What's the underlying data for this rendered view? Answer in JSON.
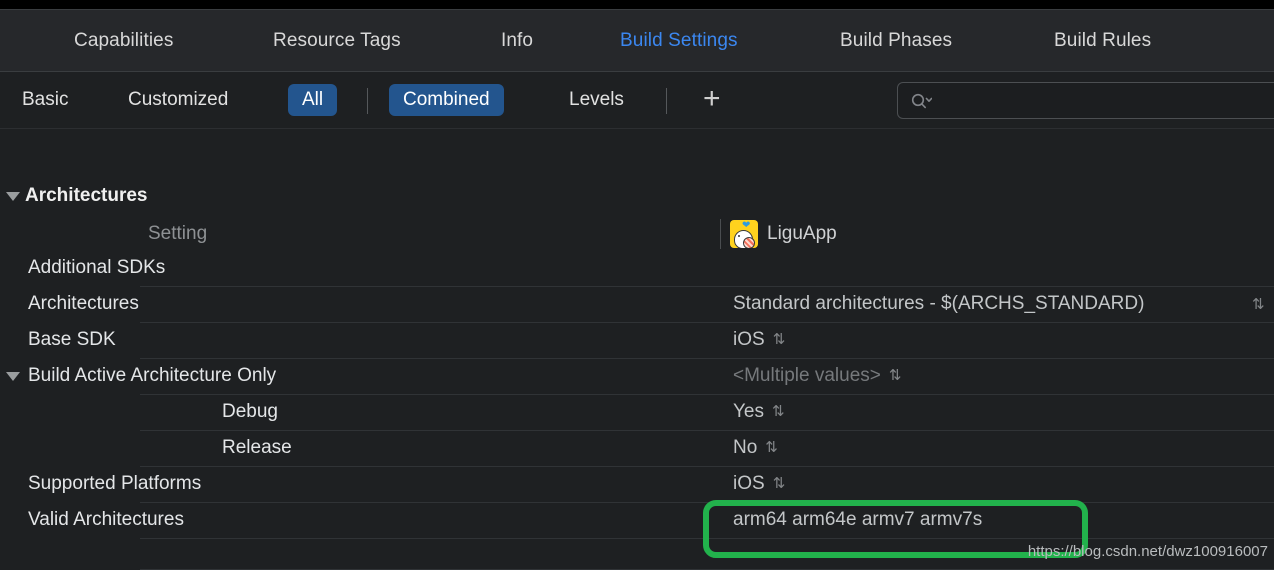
{
  "window": {
    "theme_background": "#1e2022",
    "accent_blue": "#3b87f0",
    "selected_blue": "#23558e",
    "annotation_green": "#22b24c"
  },
  "tabbar": {
    "tabs": [
      {
        "label": "Capabilities",
        "active": false
      },
      {
        "label": "Resource Tags",
        "active": false
      },
      {
        "label": "Info",
        "active": false
      },
      {
        "label": "Build Settings",
        "active": true
      },
      {
        "label": "Build Phases",
        "active": false
      },
      {
        "label": "Build Rules",
        "active": false
      }
    ]
  },
  "filterbar": {
    "buttons": [
      {
        "label": "Basic",
        "selected": false
      },
      {
        "label": "Customized",
        "selected": false
      },
      {
        "label": "All",
        "selected": true
      },
      {
        "label": "Combined",
        "selected": true
      },
      {
        "label": "Levels",
        "selected": false
      }
    ],
    "add_label": "+",
    "search": {
      "value": "",
      "placeholder": ""
    }
  },
  "table": {
    "group_title": "Architectures",
    "column_headers": {
      "setting": "Setting",
      "target": "LiguApp"
    },
    "rows": [
      {
        "name": "Additional SDKs",
        "indent": 0,
        "expandable": false,
        "value": "",
        "stepper": false,
        "muted": false
      },
      {
        "name": "Architectures",
        "indent": 0,
        "expandable": false,
        "value": "Standard architectures  -  $(ARCHS_STANDARD)",
        "stepper": true,
        "muted": false
      },
      {
        "name": "Base SDK",
        "indent": 0,
        "expandable": false,
        "value": "iOS",
        "stepper": true,
        "muted": false
      },
      {
        "name": "Build Active Architecture Only",
        "indent": 0,
        "expandable": true,
        "value": "<Multiple values>",
        "stepper": true,
        "muted": true
      },
      {
        "name": "Debug",
        "indent": 1,
        "expandable": false,
        "value": "Yes",
        "stepper": true,
        "muted": false
      },
      {
        "name": "Release",
        "indent": 1,
        "expandable": false,
        "value": "No",
        "stepper": true,
        "muted": false
      },
      {
        "name": "Supported Platforms",
        "indent": 0,
        "expandable": false,
        "value": "iOS",
        "stepper": true,
        "muted": false
      },
      {
        "name": "Valid Architectures",
        "indent": 0,
        "expandable": false,
        "value": "arm64 arm64e armv7 armv7s",
        "stepper": false,
        "muted": false
      }
    ]
  },
  "annotation": {
    "highlight_target": "arm64 arm64e armv7 armv7s"
  },
  "watermark": {
    "text": "https://blog.csdn.net/dwz100916007"
  }
}
